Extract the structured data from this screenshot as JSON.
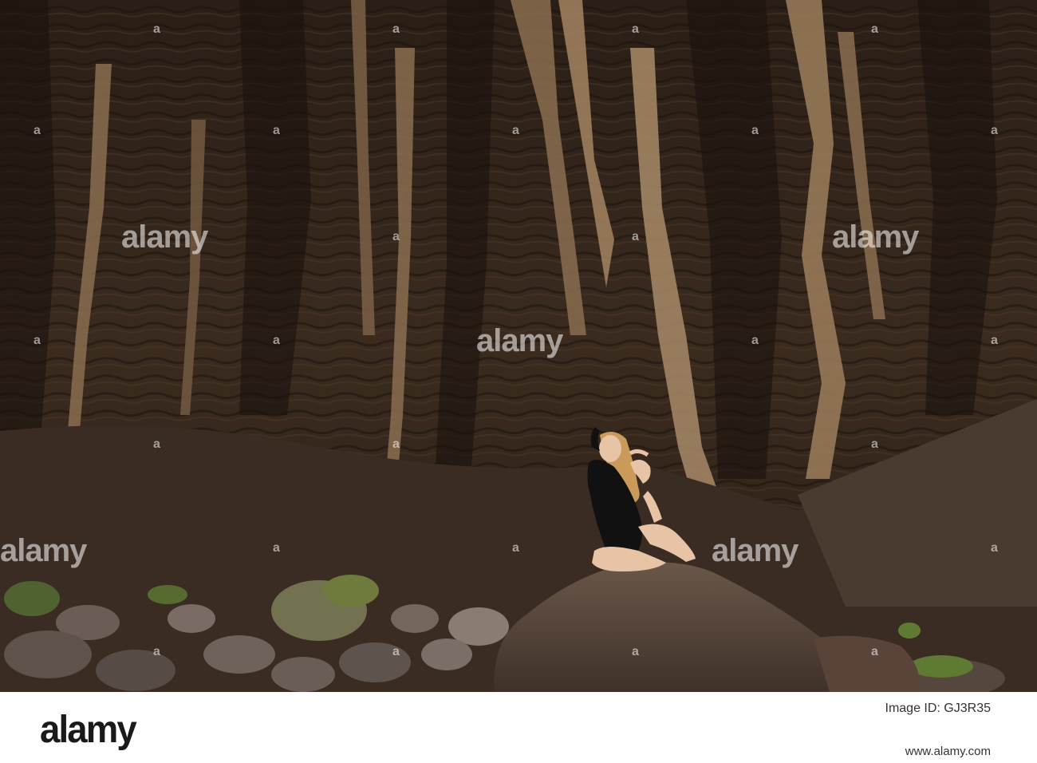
{
  "watermark": {
    "main": "alamy",
    "small": "a"
  },
  "footer": {
    "logo": "alamy",
    "image_id_label": "Image ID: GJ3R35",
    "image_id": "",
    "url": "www.alamy.com"
  },
  "colors": {
    "rock_dark": "#2e2118",
    "rock_mid": "#5a4330",
    "rock_light": "#a88a68",
    "boulder": "#5b4a40",
    "outfit": "#111111",
    "skin": "#e8c4a6",
    "hair": "#c99a5a",
    "shrub": "#6e7b3d"
  }
}
